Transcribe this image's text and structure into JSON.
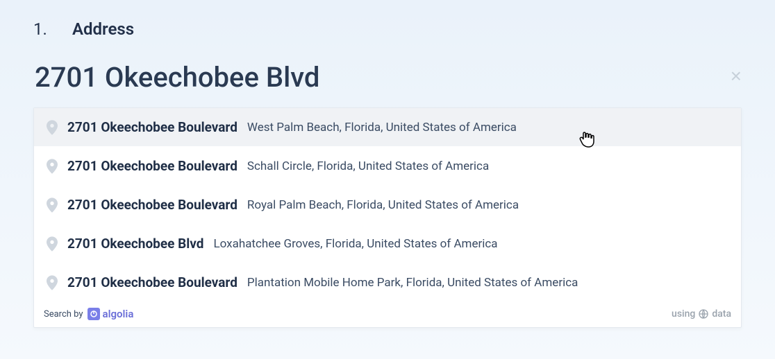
{
  "step_number": "1.",
  "heading": "Address",
  "input": {
    "value": "2701 Okeechobee Blvd",
    "clear_label": "×"
  },
  "suggestions": [
    {
      "primary": "2701 Okeechobee Boulevard",
      "secondary": "West Palm Beach, Florida, United States of America",
      "highlight": true
    },
    {
      "primary": "2701 Okeechobee Boulevard",
      "secondary": "Schall Circle, Florida, United States of America",
      "highlight": false
    },
    {
      "primary": "2701 Okeechobee Boulevard",
      "secondary": "Royal Palm Beach, Florida, United States of America",
      "highlight": false
    },
    {
      "primary": "2701 Okeechobee Blvd",
      "secondary": "Loxahatchee Groves, Florida, United States of America",
      "highlight": false
    },
    {
      "primary": "2701 Okeechobee Boulevard",
      "secondary": "Plantation Mobile Home Park, Florida, United States of America",
      "highlight": false
    }
  ],
  "footer": {
    "search_by": "Search by",
    "algolia": "algolia",
    "using": "using",
    "data": "data"
  }
}
